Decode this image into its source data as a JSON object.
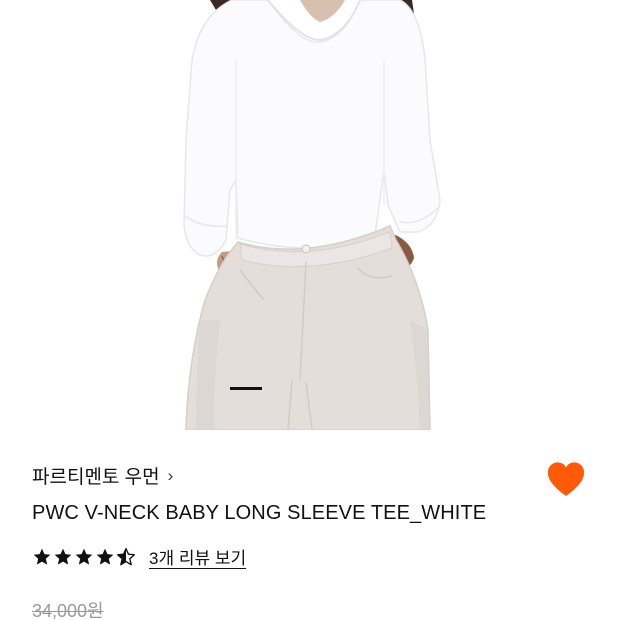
{
  "product": {
    "brand": "파르티멘토 우먼",
    "brand_chevron": "›",
    "title": "PWC V-NECK BABY LONG SLEEVE TEE_WHITE",
    "rating": 4.5,
    "rating_max": 5,
    "review_link": "3개 리뷰 보기",
    "original_price": "34,000원",
    "liked": true
  },
  "gallery": {
    "image_icon": "product-photo",
    "slide_indicator": "active-slide-bar"
  },
  "colors": {
    "heart": "#FF5A0A",
    "star": "#111111",
    "price_strike": "#9a9a9a"
  }
}
